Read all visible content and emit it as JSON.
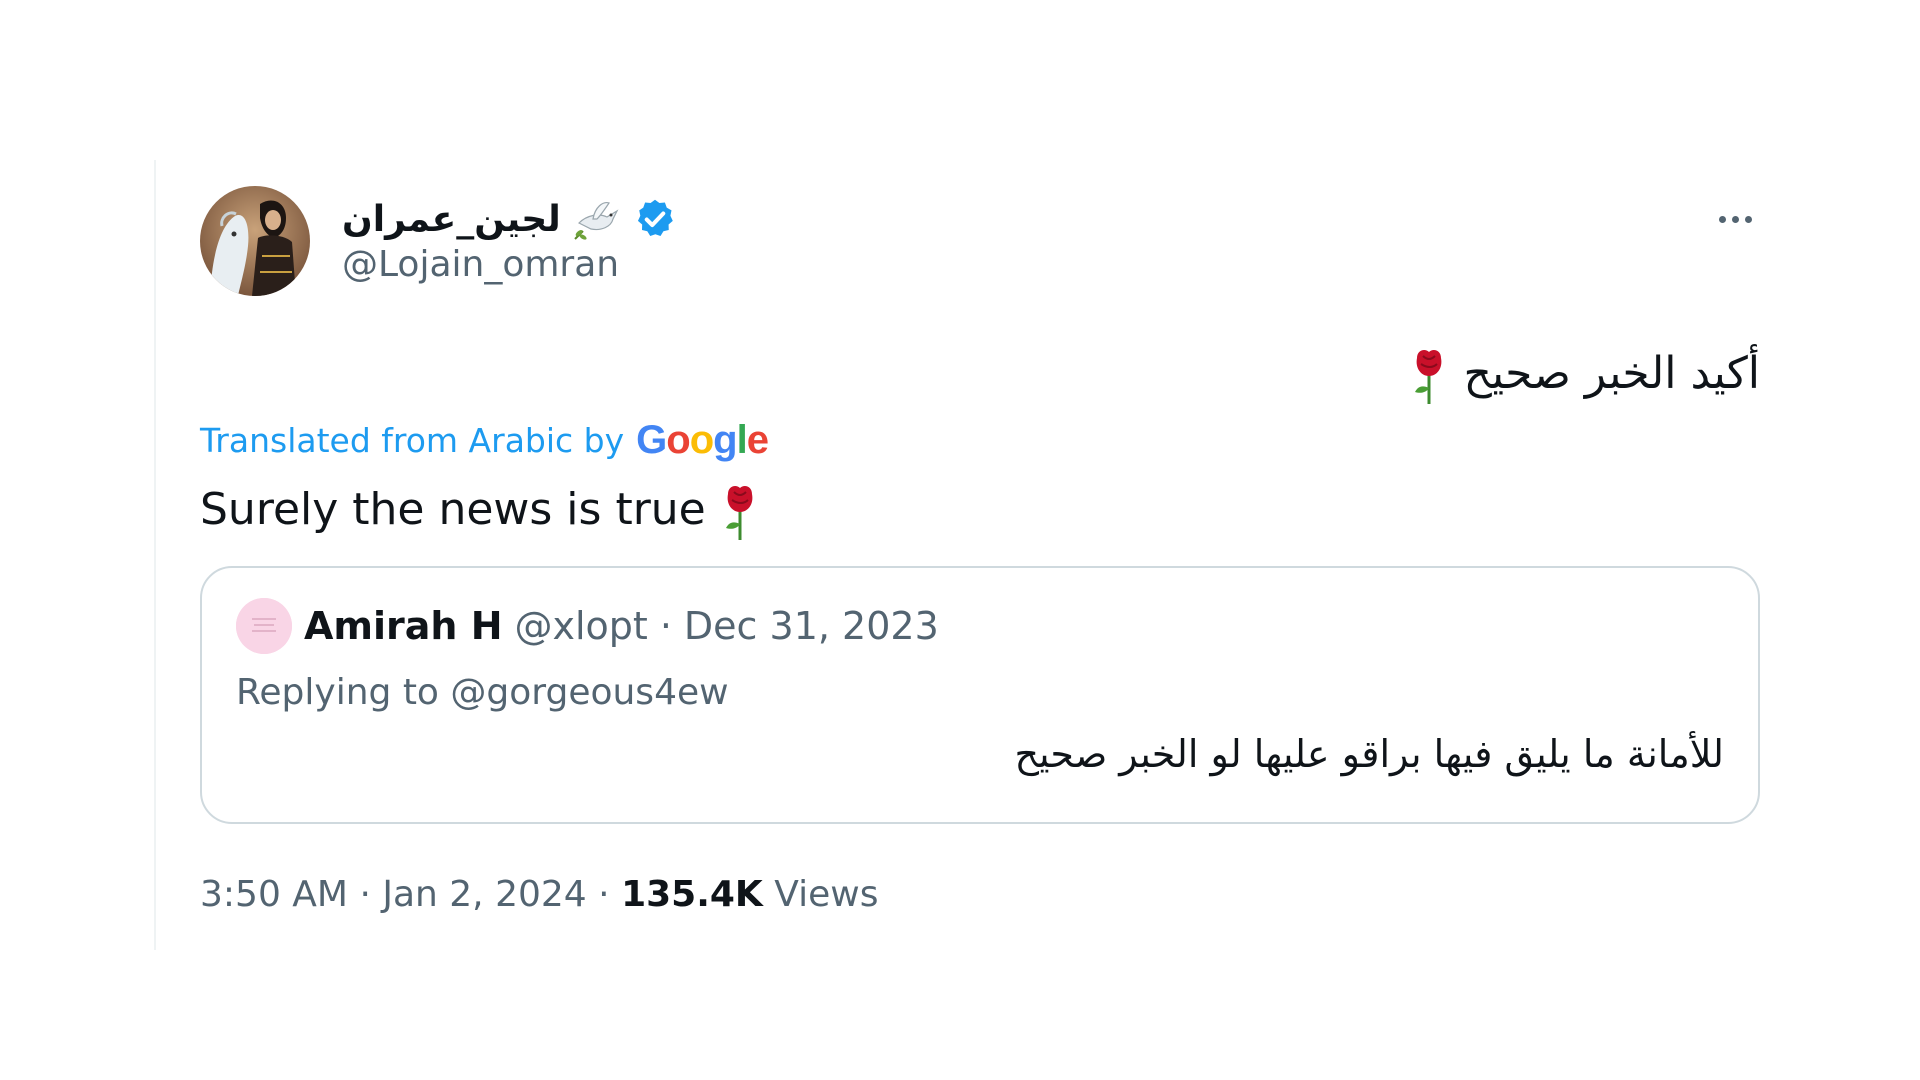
{
  "author": {
    "display_name": "لجين_عمران",
    "handle": "@Lojain_omran"
  },
  "tweet": {
    "original_text": "أكيد الخبر صحيح",
    "translation_label": "Translated from Arabic by",
    "translation_provider": "Google",
    "translated_text": "Surely the news is true"
  },
  "quote": {
    "name": "Amirah H",
    "handle": "@xlopt",
    "separator": "·",
    "date": "Dec 31, 2023",
    "replying_label": "Replying to",
    "replying_handle": "@gorgeous4ew",
    "text": "للأمانة ما يليق فيها براقو عليها لو الخبر صحيح"
  },
  "footer": {
    "time": "3:50 AM",
    "separator": "·",
    "date": "Jan 2, 2024",
    "views_count": "135.4K",
    "views_label": "Views"
  },
  "icons": {
    "dove": "dove-olive-branch-icon",
    "verified": "verified-badge-icon",
    "rose": "rose-emoji-icon",
    "more": "more-options-icon"
  },
  "colors": {
    "link_blue": "#1d9bf0",
    "secondary_text": "#536471",
    "primary_text": "#0f1419",
    "border": "#cfd9de"
  }
}
